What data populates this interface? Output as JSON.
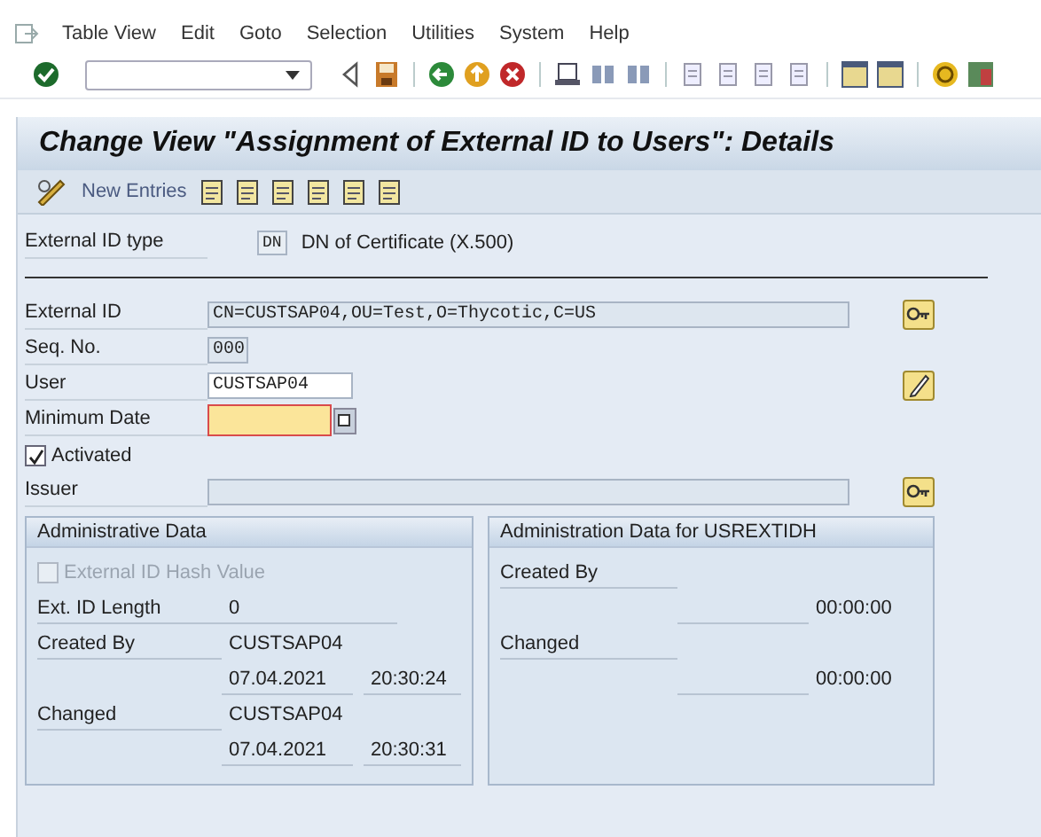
{
  "menu": [
    "Table View",
    "Edit",
    "Goto",
    "Selection",
    "Utilities",
    "System",
    "Help"
  ],
  "title": "Change View \"Assignment of External ID to Users\": Details",
  "app_toolbar": {
    "new_entries": "New Entries"
  },
  "id_type": {
    "label": "External ID type",
    "code": "DN",
    "description": "DN of Certificate (X.500)"
  },
  "fields": [
    {
      "kind": "long",
      "label": "External ID",
      "value": "CN=CUSTSAP04,OU=Test,O=Thycotic,C=US",
      "editable": false
    },
    {
      "kind": "short",
      "label": "Seq. No.",
      "value": "000",
      "editable": false
    },
    {
      "kind": "input",
      "label": "User",
      "value": "CUSTSAP04",
      "editable": true
    },
    {
      "kind": "date",
      "label": "Minimum Date",
      "editable": true,
      "required": true
    },
    {
      "kind": "check",
      "label": "Activated",
      "checked": true
    },
    {
      "kind": "long",
      "label": "Issuer",
      "editable": false
    }
  ],
  "admin_data": {
    "title": "Administrative Data",
    "hash": {
      "label": "External ID Hash Value",
      "checked": false,
      "disabled": true
    },
    "length": {
      "label": "Ext. ID Length",
      "value": "0"
    },
    "rows": [
      {
        "label": "Created By",
        "user": "CUSTSAP04",
        "date": "07.04.2021",
        "time": "20:30:24"
      },
      {
        "label": "Changed",
        "user": "CUSTSAP04",
        "date": "07.04.2021",
        "time": "20:30:31"
      }
    ]
  },
  "admin_data_table": {
    "title": "Administration Data for USREXTIDH",
    "rows": [
      {
        "label": "Created By",
        "time": "00:00:00"
      },
      {
        "label": "Changed",
        "time": "00:00:00"
      }
    ]
  }
}
